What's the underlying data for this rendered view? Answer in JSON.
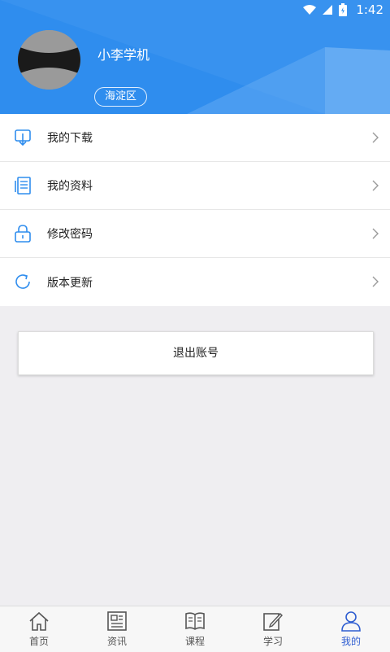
{
  "status_bar": {
    "time": "1:42"
  },
  "profile": {
    "name": "小李学机",
    "district": "海淀区"
  },
  "menu": [
    {
      "label": "我的下载",
      "icon": "download-icon"
    },
    {
      "label": "我的资料",
      "icon": "documents-icon"
    },
    {
      "label": "修改密码",
      "icon": "lock-icon"
    },
    {
      "label": "版本更新",
      "icon": "refresh-icon"
    }
  ],
  "logout_label": "退出账号",
  "bottom_nav": [
    {
      "label": "首页",
      "icon": "home-icon"
    },
    {
      "label": "资讯",
      "icon": "news-icon"
    },
    {
      "label": "课程",
      "icon": "book-icon"
    },
    {
      "label": "学习",
      "icon": "edit-icon"
    },
    {
      "label": "我的",
      "icon": "user-icon",
      "active": true
    }
  ],
  "colors": {
    "header": "#2f8dee",
    "accent": "#2f5ed1",
    "icon": "#2f8dee"
  }
}
